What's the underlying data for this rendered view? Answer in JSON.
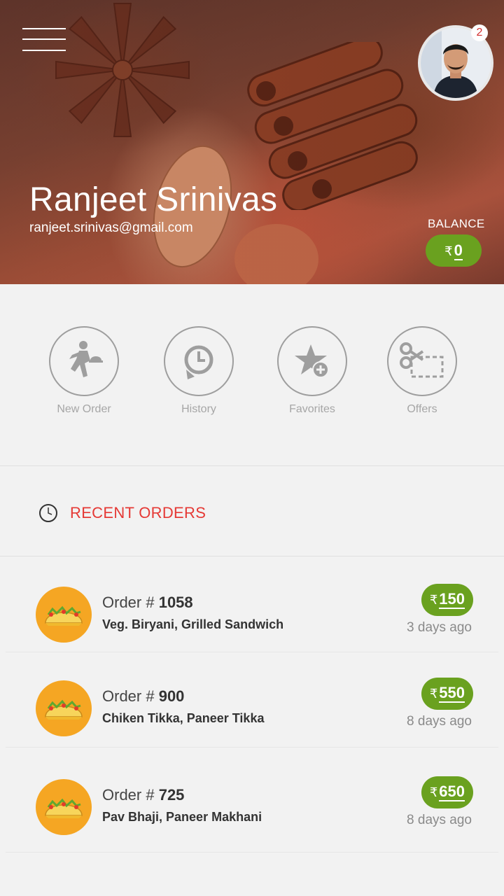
{
  "profile": {
    "name": "Ranjeet Srinivas",
    "email": "ranjeet.srinivas@gmail.com",
    "notification_count": "2",
    "balance_label": "BALANCE",
    "currency": "₹",
    "balance": "0"
  },
  "actions": [
    {
      "label": "New Order",
      "icon": "running-waiter-icon"
    },
    {
      "label": "History",
      "icon": "history-clock-icon"
    },
    {
      "label": "Favorites",
      "icon": "star-add-icon"
    },
    {
      "label": "Offers",
      "icon": "scissors-coupon-icon"
    }
  ],
  "recent": {
    "title": "RECENT ORDERS",
    "order_prefix": "Order # ",
    "currency": "₹",
    "orders": [
      {
        "number": "1058",
        "items": "Veg. Biryani, Grilled Sandwich",
        "price": "150",
        "ago": "3 days ago"
      },
      {
        "number": "900",
        "items": "Chiken Tikka, Paneer Tikka",
        "price": "550",
        "ago": "8 days ago"
      },
      {
        "number": "725",
        "items": "Pav Bhaji, Paneer Makhani",
        "price": "650",
        "ago": "8 days ago"
      }
    ]
  },
  "colors": {
    "accent_green": "#6aa11f",
    "recent_red": "#e53935",
    "thumb_orange": "#f5a623"
  }
}
